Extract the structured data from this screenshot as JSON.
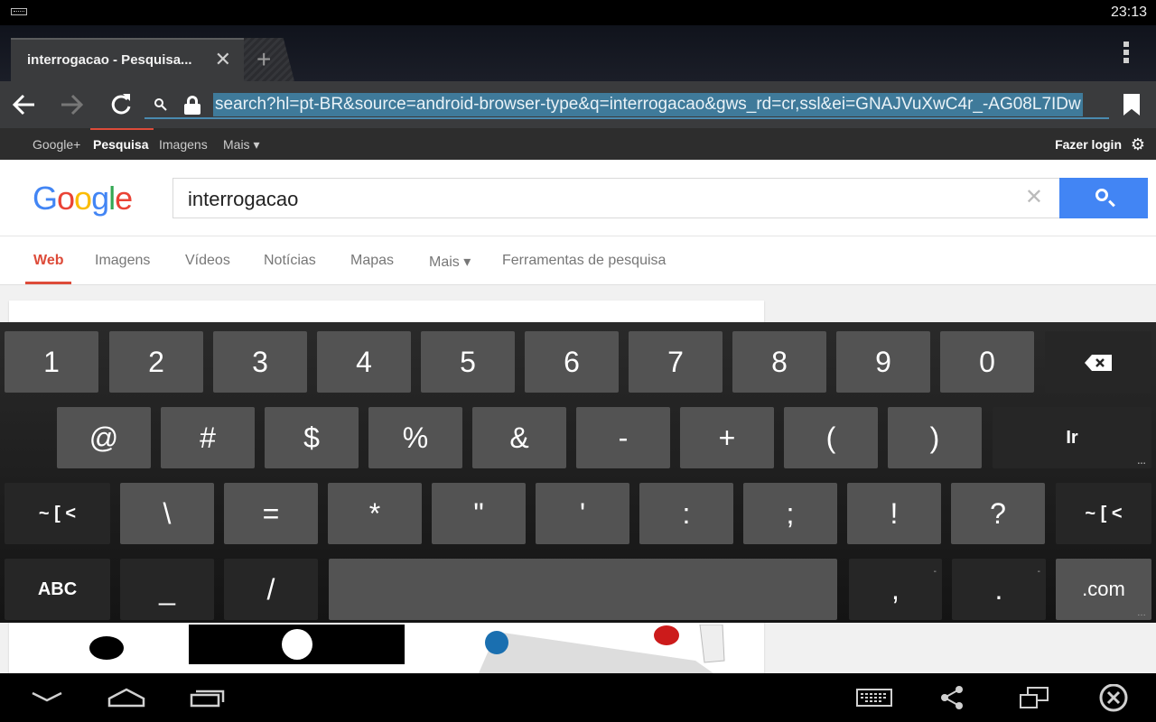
{
  "status_bar": {
    "time": "23:13"
  },
  "browser": {
    "tab_title": "interrogacao - Pesquisa...",
    "tab_close": "✕",
    "new_tab": "+",
    "url": "search?hl=pt-BR&source=android-browser-type&q=interrogacao&gws_rd=cr,ssl&ei=GNAJVuXwC4r_-AG08L7IDw"
  },
  "google_bar": {
    "links": [
      "Google+",
      "Pesquisa",
      "Imagens",
      "Mais ▾"
    ],
    "active": "Pesquisa",
    "login": "Fazer login"
  },
  "google": {
    "logo_letters": [
      "G",
      "o",
      "o",
      "g",
      "l",
      "e"
    ],
    "logo_colors": [
      "#4285f4",
      "#ea4335",
      "#fbbc05",
      "#4285f4",
      "#34a853",
      "#ea4335"
    ],
    "query": "interrogacao",
    "clear": "✕"
  },
  "search_tabs": [
    "Web",
    "Imagens",
    "Vídeos",
    "Notícias",
    "Mapas",
    "Mais ▾",
    "Ferramentas de pesquisa"
  ],
  "keyboard": {
    "row1": [
      "1",
      "2",
      "3",
      "4",
      "5",
      "6",
      "7",
      "8",
      "9",
      "0"
    ],
    "row2": [
      "@",
      "#",
      "$",
      "%",
      "&",
      "-",
      "+",
      "(",
      ")"
    ],
    "go": "Ir",
    "row3_shift": "~ [ <",
    "row3": [
      "\\",
      "=",
      "*",
      "\"",
      "'",
      ":",
      ";",
      "!",
      "?"
    ],
    "row4_abc": "ABC",
    "row4": [
      "_",
      "/"
    ],
    "comma": ",",
    "period": ".",
    "dotcom": ".com",
    "hint_dots": "…",
    "hint_dash": "-"
  },
  "colors": {
    "accent_red": "#dd4b39",
    "search_blue": "#4285f4",
    "url_highlight": "#3f7a9a"
  }
}
